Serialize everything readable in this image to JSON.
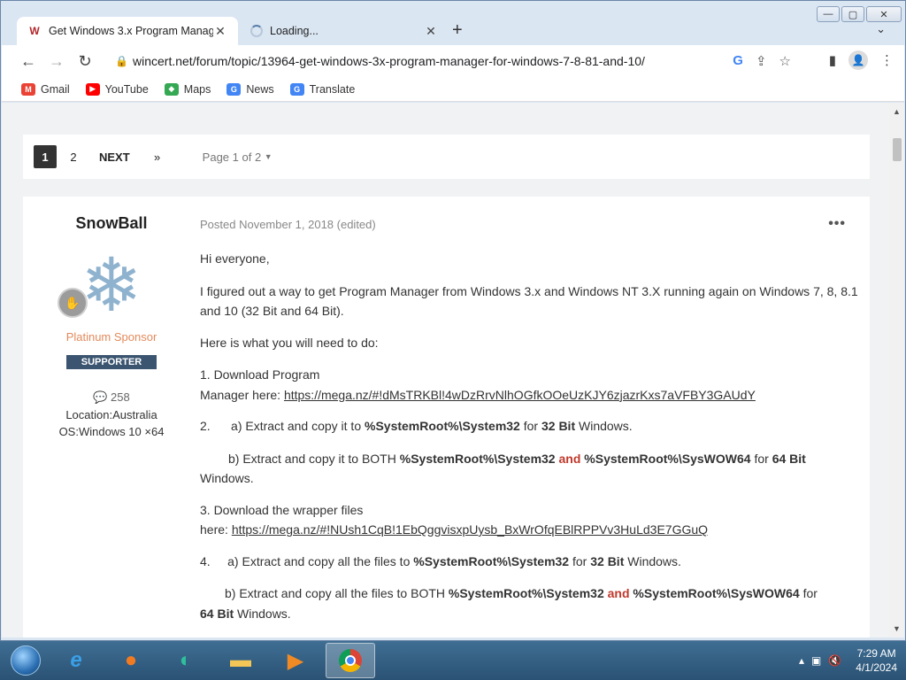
{
  "tabs": [
    {
      "label": "Get Windows 3.x Program Manag",
      "favicon": "W"
    },
    {
      "label": "Loading..."
    }
  ],
  "window_controls": {
    "minimize": "—",
    "maximize": "▢",
    "close": "✕"
  },
  "toolbar": {
    "url": "wincert.net/forum/topic/13964-get-windows-3x-program-manager-for-windows-7-8-81-and-10/"
  },
  "bookmarks": [
    {
      "label": "Gmail",
      "icon": "gmail-icon",
      "color": "#ea4335"
    },
    {
      "label": "YouTube",
      "icon": "youtube-icon",
      "color": "#ff0000"
    },
    {
      "label": "Maps",
      "icon": "maps-icon",
      "color": "#34a853"
    },
    {
      "label": "News",
      "icon": "news-icon",
      "color": "#4285f4"
    },
    {
      "label": "Translate",
      "icon": "translate-icon",
      "color": "#4285f4"
    }
  ],
  "pager": {
    "pages": [
      "1",
      "2"
    ],
    "next": "NEXT",
    "last": "»",
    "page_of": "Page 1 of 2"
  },
  "post": {
    "author": "SnowBall",
    "group": "Platinum Sponsor",
    "supporter": "SUPPORTER",
    "post_count": "258",
    "location": "Location:Australia",
    "os": "OS:Windows 10 ×64",
    "meta": "Posted November 1, 2018 (edited)",
    "greeting": "Hi everyone,",
    "intro": "I figured out a way to get Program Manager from Windows 3.x and Windows NT 3.X running again on Windows 7, 8, 8.1 and 10 (32 Bit and 64 Bit).",
    "need": "Here is what you will need to do:",
    "step1a": "1. Download Program",
    "step1b": "Manager here: ",
    "link1": "https://mega.nz/#!dMsTRKBl!4wDzRrvNlhOGfkOOeUzKJY6zjazrKxs7aVFBY3GAUdY",
    "step2_num": "2.",
    "step2a_pre": "a) Extract and copy it to ",
    "sysroot32": "%SystemRoot%\\System32",
    "for_word": " for ",
    "bit32": "32 Bit",
    "windows_dot": " Windows.",
    "step2b_pre": "b) Extract and copy it to BOTH ",
    "and_word": "and",
    "syswow": "%SystemRoot%\\SysWOW64",
    "bit64": "64 Bit",
    "windows_word": "Windows.",
    "step3a": "3. Download the wrapper files",
    "step3b": "here: ",
    "link2": "https://mega.nz/#!NUsh1CqB!1EbQggvisxpUysb_BxWrOfqEBlRPPVv3HuLd3E7GGuQ",
    "step4_num": "4.",
    "step4a_pre": "a) Extract and copy all the files to ",
    "step4b_pre": "b) Extract and copy all the files to BOTH ",
    "for_end": " for",
    "windows_dot2": " Windows."
  },
  "taskbar": {
    "time": "7:29 AM",
    "date": "4/1/2024"
  }
}
